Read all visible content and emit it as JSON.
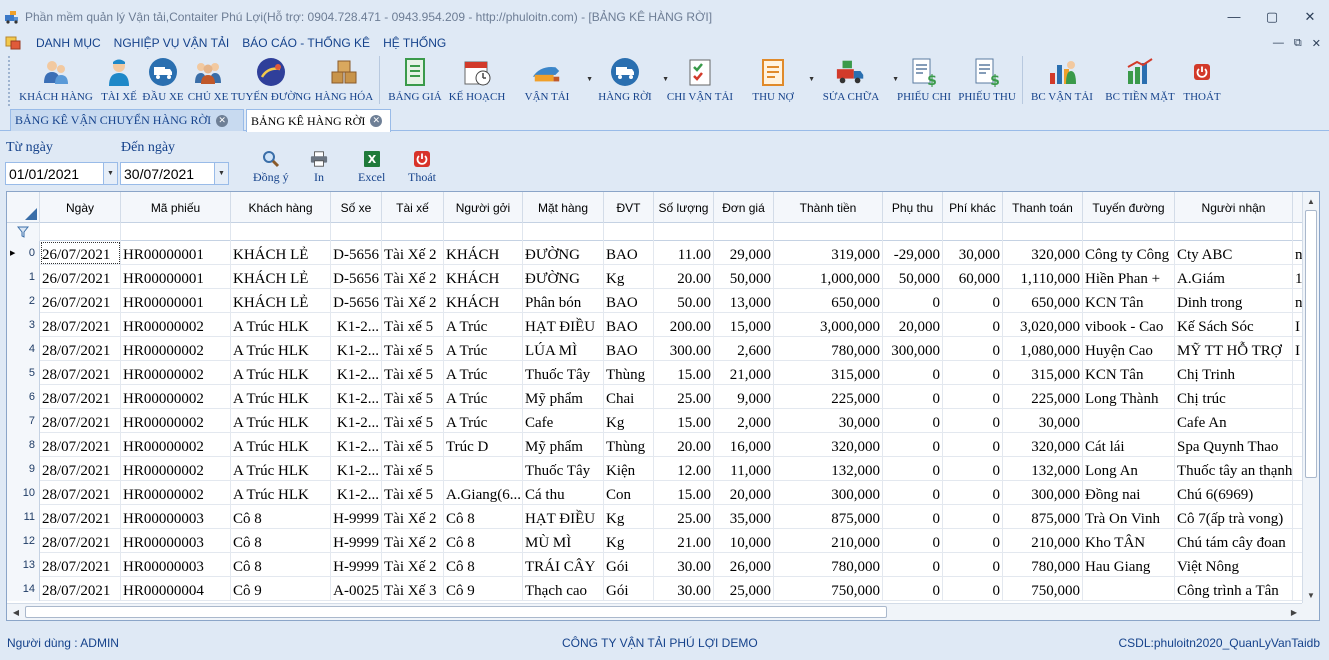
{
  "window": {
    "title": "Phần mềm quản lý Vận tải,Contaiter Phú Lợi(Hỗ trợ: 0904.728.471 - 0943.954.209 - http://phuloitn.com) - [BẢNG KÊ HÀNG RỜI]",
    "minimize": "—",
    "maximize": "▢",
    "close": "✕"
  },
  "menu": {
    "items": [
      "DANH MỤC",
      "NGHIỆP VỤ VẬN TẢI",
      "BÁO CÁO - THỐNG KÊ",
      "HỆ THỐNG"
    ],
    "mdi": [
      "—",
      "⧉",
      "✕"
    ]
  },
  "toolbar": {
    "buttons": [
      {
        "label": "KHÁCH HÀNG",
        "icon": "customers-icon",
        "color": "#3b6fb6"
      },
      {
        "label": "TÀI XẾ",
        "icon": "driver-icon",
        "color": "#1e88c8"
      },
      {
        "label": "ĐẦU XE",
        "icon": "truck-icon",
        "color": "#2a6fb0"
      },
      {
        "label": "CHỦ XE",
        "icon": "owners-icon",
        "color": "#c0582a"
      },
      {
        "label": "TUYẾN ĐƯỜNG",
        "icon": "route-icon",
        "color": "#2f3f9a"
      },
      {
        "label": "HÀNG HÓA",
        "icon": "boxes-icon",
        "color": "#c8944a"
      },
      {
        "label": "BẢNG GIÁ",
        "icon": "price-list-icon",
        "color": "#3a9a4a"
      },
      {
        "label": "KẾ HOẠCH",
        "icon": "calendar-icon",
        "color": "#d23a2a"
      },
      {
        "label": "VẬN TẢI",
        "icon": "transport-icon",
        "color": "#3c86c9",
        "dropdown": true
      },
      {
        "label": "HÀNG RỜI",
        "icon": "bulk-truck-icon",
        "color": "#2a6fb0",
        "dropdown": true
      },
      {
        "label": "CHI VẬN TẢI",
        "icon": "checklist-icon",
        "color": "#3a9a4a"
      },
      {
        "label": "THU NỢ",
        "icon": "debt-icon",
        "color": "#e08a2a",
        "dropdown": true
      },
      {
        "label": "SỬA CHỮA",
        "icon": "repair-icon",
        "color": "#d23a2a",
        "dropdown": true
      },
      {
        "label": "PHIẾU CHI",
        "icon": "payment-voucher-icon",
        "color": "#3a9a4a"
      },
      {
        "label": "PHIẾU THU",
        "icon": "receipt-voucher-icon",
        "color": "#3a9a4a"
      },
      {
        "label": "BC VẬN TẢI",
        "icon": "bar-report-icon",
        "color": "#2a6fb0"
      },
      {
        "label": "BC TIỀN MẶT",
        "icon": "cash-report-icon",
        "color": "#3a9a4a"
      },
      {
        "label": "THOÁT",
        "icon": "power-icon",
        "color": "#d23a2a"
      }
    ]
  },
  "tabs": [
    {
      "label": "BẢNG KÊ VẬN CHUYỂN HÀNG RỜI",
      "active": false
    },
    {
      "label": "BẢNG KÊ HÀNG RỜI",
      "active": true
    }
  ],
  "filters": {
    "from_label": "Từ ngày",
    "from_value": "01/01/2021",
    "to_label": "Đến ngày",
    "to_value": "30/07/2021",
    "buttons": [
      {
        "label": "Đồng ý",
        "icon": "search-icon"
      },
      {
        "label": "In",
        "icon": "printer-icon"
      },
      {
        "label": "Excel",
        "icon": "excel-icon"
      },
      {
        "label": "Thoát",
        "icon": "power-icon"
      }
    ]
  },
  "grid": {
    "columns": [
      "Ngày",
      "Mã phiếu",
      "Khách hàng",
      "Số xe",
      "Tài xế",
      "Người gởi",
      "Mặt hàng",
      "ĐVT",
      "Số lượng",
      "Đơn giá",
      "Thành tiền",
      "Phụ thu",
      "Phí khác",
      "Thanh toán",
      "Tuyến đường",
      "Người nhận",
      ""
    ],
    "rows": [
      [
        "0",
        "26/07/2021",
        "HR00000001",
        "KHÁCH LẺ",
        "D-5656",
        "Tài Xế 2",
        "KHÁCH",
        "ĐƯỜNG",
        "BAO",
        "11.00",
        "29,000",
        "319,000",
        "-29,000",
        "30,000",
        "320,000",
        "Công ty Công",
        "Cty ABC",
        "n"
      ],
      [
        "1",
        "26/07/2021",
        "HR00000001",
        "KHÁCH LẺ",
        "D-5656",
        "Tài Xế 2",
        "KHÁCH",
        "ĐƯỜNG",
        "Kg",
        "20.00",
        "50,000",
        "1,000,000",
        "50,000",
        "60,000",
        "1,110,000",
        "Hiền Phan +",
        "A.Giám",
        "1"
      ],
      [
        "2",
        "26/07/2021",
        "HR00000001",
        "KHÁCH LẺ",
        "D-5656",
        "Tài Xế 2",
        "KHÁCH",
        "Phân bón",
        "BAO",
        "50.00",
        "13,000",
        "650,000",
        "0",
        "0",
        "650,000",
        "KCN Tân",
        "Dinh trong",
        "n"
      ],
      [
        "3",
        "28/07/2021",
        "HR00000002",
        "A Trúc HLK",
        "K1-2...",
        "Tài xế 5",
        "A Trúc",
        "HẠT ĐIỀU",
        "BAO",
        "200.00",
        "15,000",
        "3,000,000",
        "20,000",
        "0",
        "3,020,000",
        "vibook - Cao",
        "Kế Sách Sóc",
        "I"
      ],
      [
        "4",
        "28/07/2021",
        "HR00000002",
        "A Trúc HLK",
        "K1-2...",
        "Tài xế 5",
        "A Trúc",
        "LÚA MÌ",
        "BAO",
        "300.00",
        "2,600",
        "780,000",
        "300,000",
        "0",
        "1,080,000",
        "Huyện Cao",
        "MỸ TT HỖ TRỢ",
        "I"
      ],
      [
        "5",
        "28/07/2021",
        "HR00000002",
        "A Trúc HLK",
        "K1-2...",
        "Tài xế 5",
        "A Trúc",
        "Thuốc Tây",
        "Thùng",
        "15.00",
        "21,000",
        "315,000",
        "0",
        "0",
        "315,000",
        "KCN Tân",
        "Chị Trinh",
        ""
      ],
      [
        "6",
        "28/07/2021",
        "HR00000002",
        "A Trúc HLK",
        "K1-2...",
        "Tài xế 5",
        "A Trúc",
        "Mỹ phẩm",
        "Chai",
        "25.00",
        "9,000",
        "225,000",
        "0",
        "0",
        "225,000",
        "Long Thành",
        "Chị trúc",
        ""
      ],
      [
        "7",
        "28/07/2021",
        "HR00000002",
        "A Trúc HLK",
        "K1-2...",
        "Tài xế 5",
        "A Trúc",
        "Cafe",
        "Kg",
        "15.00",
        "2,000",
        "30,000",
        "0",
        "0",
        "30,000",
        "",
        "Cafe An",
        ""
      ],
      [
        "8",
        "28/07/2021",
        "HR00000002",
        "A Trúc HLK",
        "K1-2...",
        "Tài xế 5",
        "Trúc D",
        "Mỹ phẩm",
        "Thùng",
        "20.00",
        "16,000",
        "320,000",
        "0",
        "0",
        "320,000",
        "Cát lái",
        "Spa Quynh Thao",
        ""
      ],
      [
        "9",
        "28/07/2021",
        "HR00000002",
        "A Trúc HLK",
        "K1-2...",
        "Tài xế 5",
        "",
        "Thuốc Tây",
        "Kiện",
        "12.00",
        "11,000",
        "132,000",
        "0",
        "0",
        "132,000",
        "Long An",
        "Thuốc tây an thạnh",
        ""
      ],
      [
        "10",
        "28/07/2021",
        "HR00000002",
        "A Trúc HLK",
        "K1-2...",
        "Tài xế 5",
        "A.Giang(6...",
        "Cá thu",
        "Con",
        "15.00",
        "20,000",
        "300,000",
        "0",
        "0",
        "300,000",
        "Đồng nai",
        "Chú 6(6969)",
        ""
      ],
      [
        "11",
        "28/07/2021",
        "HR00000003",
        "Cô 8",
        "H-9999",
        "Tài Xế 2",
        "Cô 8",
        "HẠT ĐIỀU",
        "Kg",
        "25.00",
        "35,000",
        "875,000",
        "0",
        "0",
        "875,000",
        "Trà On Vinh",
        "Cô 7(ấp trà vong)",
        ""
      ],
      [
        "12",
        "28/07/2021",
        "HR00000003",
        "Cô 8",
        "H-9999",
        "Tài Xế 2",
        "Cô 8",
        "MÙ MÌ",
        "Kg",
        "21.00",
        "10,000",
        "210,000",
        "0",
        "0",
        "210,000",
        "Kho TÂN",
        "Chú tám cây đoan",
        ""
      ],
      [
        "13",
        "28/07/2021",
        "HR00000003",
        "Cô 8",
        "H-9999",
        "Tài Xế 2",
        "Cô 8",
        "TRÁI CÂY",
        "Gói",
        "30.00",
        "26,000",
        "780,000",
        "0",
        "0",
        "780,000",
        "Hau Giang",
        "Việt Nông",
        ""
      ],
      [
        "14",
        "28/07/2021",
        "HR00000004",
        "Cô 9",
        "A-0025",
        "Tài Xế 3",
        "Cô 9",
        "Thạch cao",
        "Gói",
        "30.00",
        "25,000",
        "750,000",
        "0",
        "0",
        "750,000",
        "",
        "Công trình a Tân",
        ""
      ]
    ]
  },
  "status": {
    "user": "Người dùng : ADMIN",
    "company": "CÔNG TY VẬN TẢI PHÚ LỢI DEMO",
    "db": "CSDL:phuloitn2020_QuanLyVanTaidb"
  }
}
